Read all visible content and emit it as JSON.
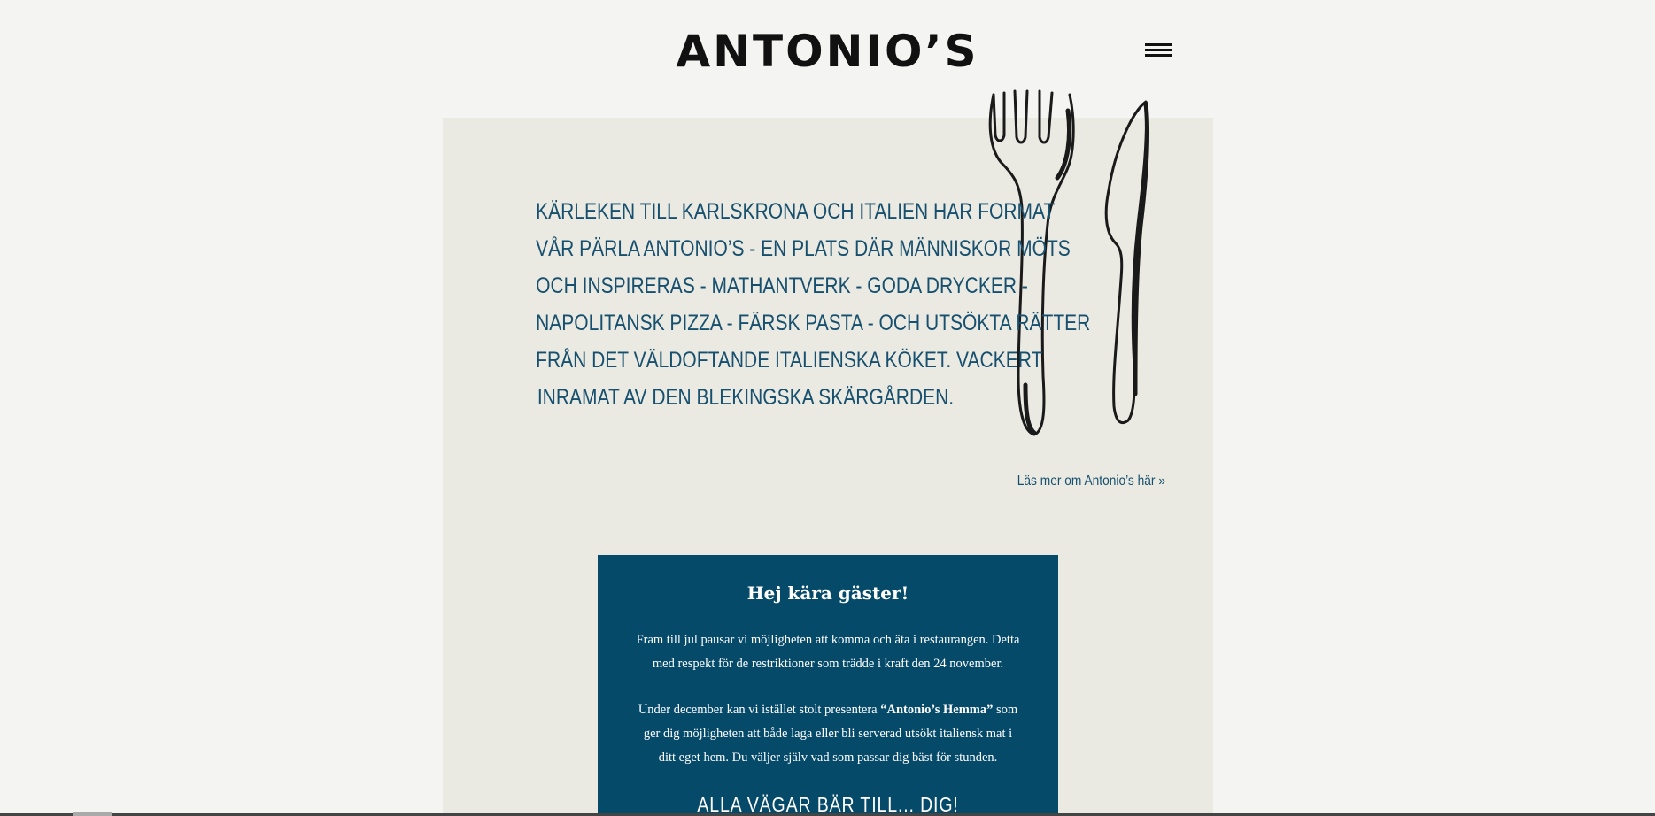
{
  "header": {
    "logo": "ANTONIO’S",
    "menu_icon": "hamburger-menu-icon"
  },
  "intro": {
    "lines": [
      "KÄRLEKEN TILL KARLSKRONA OCH ITALIEN HAR FORMAT",
      "VÅR PÄRLA ANTONIO’S - EN PLATS DÄR MÄNNISKOR MÖTS",
      "OCH INSPIRERAS - MATHANTVERK - GODA DRYCKER -",
      "NAPOLITANSK PIZZA - FÄRSK PASTA - OCH UTSÖKTA RÄTTER",
      "FRÅN DET VÄLDOFTANDE ITALIENSKA KÖKET. VACKERT",
      "INRAMAT AV DEN BLEKINGSKA SKÄRGÅRDEN."
    ],
    "illustration_icon": "fork-and-knife-icon",
    "read_more": "Läs mer om Antonio’s här »"
  },
  "notice": {
    "title": "Hej kära gäster!",
    "paragraph1": [
      "Fram till jul pausar vi möjligheten att komma och äta i restaurangen. Detta",
      "med respekt för de restriktioner som trädde i kraft den 24 november."
    ],
    "paragraph2": {
      "line1_before": "Under december kan vi istället stolt presentera ",
      "line1_bold": "“Antonio’s Hemma”",
      "line1_after": " som",
      "line2": "ger dig möjligheten att både laga eller bli serverad utsökt italiensk mat i",
      "line3": "ditt eget hem. Du väljer själv vad som passar dig bäst för stunden."
    },
    "slogan": "ALLA VÄGAR BÄR TILL... DIG!"
  },
  "colors": {
    "page_bg": "#f4f4f3",
    "panel_bg": "#eae9e2",
    "accent_blue": "#17506e",
    "notice_bg": "#064a6a"
  }
}
